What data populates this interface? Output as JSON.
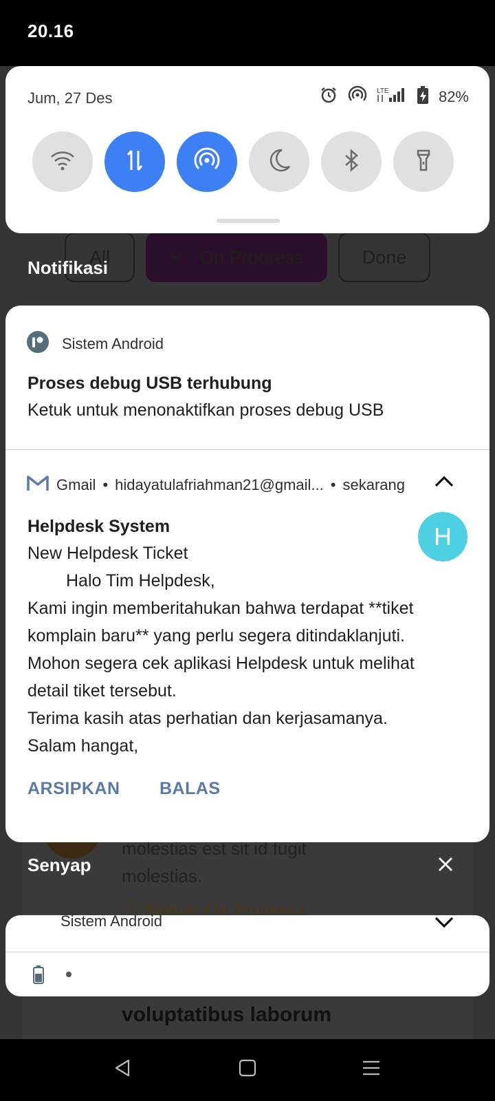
{
  "status_bar": {
    "time": "20.16"
  },
  "quick_settings": {
    "date": "Jum, 27 Des",
    "network_label": "LTE",
    "battery_percent": "82%",
    "tiles": [
      {
        "name": "wifi",
        "active": false
      },
      {
        "name": "mobile-data",
        "active": true
      },
      {
        "name": "hotspot",
        "active": true
      },
      {
        "name": "do-not-disturb",
        "active": false
      },
      {
        "name": "bluetooth",
        "active": false
      },
      {
        "name": "flashlight",
        "active": false
      }
    ]
  },
  "background_app": {
    "chips": [
      "All",
      "On Progress",
      "Done"
    ],
    "ticket_desc_1": "molestias est sit id fugit",
    "ticket_desc_2": "molestias.",
    "ticket_status": "Status: On Progress",
    "ticket_title": "voluptatibus laborum"
  },
  "notifications": {
    "section_label": "Notifikasi",
    "debug": {
      "app_name": "Sistem Android",
      "title": "Proses debug USB terhubung",
      "text": "Ketuk untuk menonaktifkan proses debug USB"
    },
    "gmail": {
      "app_name": "Gmail",
      "account": "hidayatulafriahman21@gmail...",
      "time": "sekarang",
      "avatar_letter": "H",
      "sender": "Helpdesk System",
      "subject": "New Helpdesk Ticket",
      "body_lines": [
        "Halo Tim Helpdesk,",
        "Kami ingin memberitahukan bahwa terdapat **tiket",
        "komplain baru** yang perlu segera ditindaklanjuti.",
        "Mohon segera cek aplikasi Helpdesk untuk melihat",
        "detail tiket tersebut.",
        "Terima kasih atas perhatian dan kerjasamanya.",
        "Salam hangat,"
      ],
      "actions": {
        "archive": "ARSIPKAN",
        "reply": "BALAS"
      }
    }
  },
  "silent": {
    "section_label": "Senyap",
    "app_name": "Sistem Android"
  },
  "colors": {
    "accent_blue": "#3d7ff5",
    "action_text": "#5b7aa8",
    "avatar": "#4dd0e1"
  }
}
